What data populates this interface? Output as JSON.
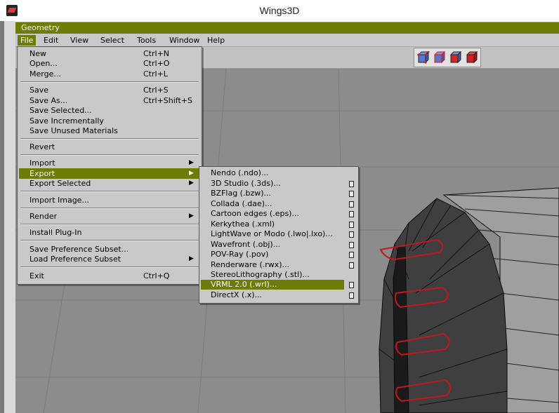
{
  "window": {
    "title": "Wings3D"
  },
  "geometry_title": "Geometry",
  "menubar": [
    {
      "label": "File",
      "active": true
    },
    {
      "label": "Edit"
    },
    {
      "label": "View"
    },
    {
      "label": "Select"
    },
    {
      "label": "Tools"
    },
    {
      "label": "Window"
    },
    {
      "label": "Help"
    }
  ],
  "toolbar": {
    "selection_modes": [
      "vertex-select-icon",
      "edge-select-icon",
      "face-select-icon",
      "body-select-icon"
    ]
  },
  "file_menu": {
    "items": [
      {
        "label": "New",
        "shortcut": "Ctrl+N"
      },
      {
        "label": "Open...",
        "shortcut": "Ctrl+O"
      },
      {
        "label": "Merge...",
        "shortcut": "Ctrl+L"
      },
      {
        "label": "Save",
        "shortcut": "Ctrl+S"
      },
      {
        "label": "Save As...",
        "shortcut": "Ctrl+Shift+S"
      },
      {
        "label": "Save Selected..."
      },
      {
        "label": "Save Incrementally"
      },
      {
        "label": "Save Unused Materials"
      },
      {
        "label": "Revert"
      },
      {
        "label": "Import",
        "submenu": true
      },
      {
        "label": "Export",
        "submenu": true,
        "highlighted": true
      },
      {
        "label": "Export Selected",
        "submenu": true
      },
      {
        "label": "Import Image..."
      },
      {
        "label": "Render",
        "submenu": true
      },
      {
        "label": "Install Plug-In"
      },
      {
        "label": "Save Preference Subset..."
      },
      {
        "label": "Load Preference Subset",
        "submenu": true
      },
      {
        "label": "Exit",
        "shortcut": "Ctrl+Q"
      }
    ]
  },
  "export_submenu": {
    "items": [
      {
        "label": "Nendo (.ndo)...",
        "options": false
      },
      {
        "label": "3D Studio (.3ds)...",
        "options": true
      },
      {
        "label": "BZFlag (.bzw)...",
        "options": true
      },
      {
        "label": "Collada (.dae)...",
        "options": true
      },
      {
        "label": "Cartoon edges (.eps)...",
        "options": true
      },
      {
        "label": "Kerkythea (.xml)",
        "options": true
      },
      {
        "label": "LightWave or Modo (.lwo|.lxo)...",
        "options": true
      },
      {
        "label": "Wavefront (.obj)...",
        "options": true
      },
      {
        "label": "POV-Ray (.pov)",
        "options": true
      },
      {
        "label": "Renderware (.rwx)...",
        "options": true
      },
      {
        "label": "StereoLithography (.stl)...",
        "options": false
      },
      {
        "label": "VRML 2.0 (.wrl)...",
        "options": true,
        "highlighted": true
      },
      {
        "label": "DirectX (.x)...",
        "options": true
      }
    ]
  },
  "colors": {
    "accent": "#6e7c05",
    "menu_bg": "#c9c9c9",
    "viewport_bg": "#8c8c8c",
    "selection_edge": "#c0181c"
  }
}
